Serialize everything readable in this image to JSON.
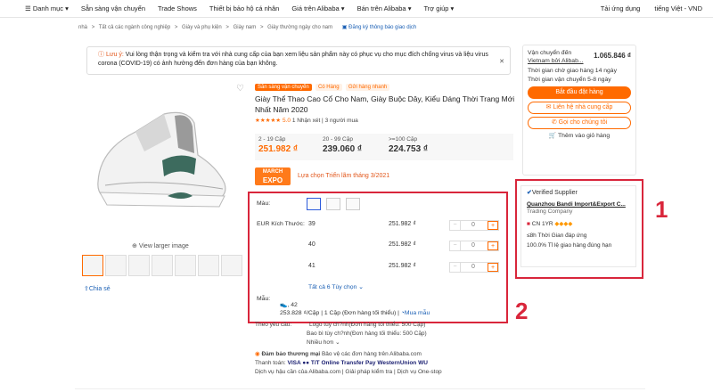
{
  "topnav": {
    "items": [
      "Danh mục",
      "Sẵn sàng vận chuyển",
      "Trade Shows",
      "Thiết bị bảo hộ cá nhân",
      "Giá trên Alibaba",
      "Bán trên Alibaba",
      "Trợ giúp"
    ],
    "right": [
      "Tải ứng dụng",
      "tiếng Việt - VND"
    ]
  },
  "breadcrumb": {
    "items": [
      "nhà",
      ">",
      "Tất cả các ngành công nghiệp",
      ">",
      "Giày và phụ kiện",
      ">",
      "Giày nam",
      ">",
      "Giày thường ngày cho nam"
    ],
    "report_link": "Đăng ký thông báo giao dịch"
  },
  "notice": {
    "warn": "Lưu ý:",
    "text": "Vui lòng thận trọng và kiểm tra với nhà cung cấp của bạn xem liệu sản phẩm này có phục vụ cho mục đích chống virus và liệu virus corona (COVID-19) có ảnh hưởng đến đơn hàng của bạn không."
  },
  "sidebar": {
    "ship_label": "Vận chuyển đến",
    "ship_price": "1.065.846 ₫",
    "ship_via": "Vietnam bởi Alibab...",
    "delivery": "Thời gian chờ giao hàng 14 ngày",
    "transit": "Thời gian vận chuyển 5-8 ngày",
    "buy_btn": "Bắt đầu đặt hàng",
    "contact_btn": "Liên hệ nhà cung cấp",
    "call_btn": "Gọi cho chúng tôi",
    "cart": "Thêm vào giỏ hàng"
  },
  "product": {
    "tags": [
      "Sẵn sàng vận chuyển",
      "Có Hàng",
      "Gửi hàng nhanh"
    ],
    "title": "Giày Thể Thao Cao Cổ Cho Nam, Giày Buộc Dây, Kiểu Dáng Thời Trang Mới Nhất Năm 2020",
    "stars": "★★★★★",
    "rating": "5.0",
    "reviews": "1 Nhận xét",
    "buyers": "3 người mua",
    "view_larger": "View larger image",
    "share": "Chia sẻ"
  },
  "tiers": [
    {
      "qty": "2 - 19 Cặp",
      "price": "251.982 ₫"
    },
    {
      "qty": "20 - 99 Cặp",
      "price": "239.060 ₫"
    },
    {
      "qty": ">=100 Cặp",
      "price": "224.753 ₫"
    }
  ],
  "expo": {
    "badge_line1": "MARCH",
    "badge_line2": "EXPO",
    "text": "Lựa chọn Triển lãm tháng 3/2021"
  },
  "variants": {
    "color_label": "Màu:",
    "size_label": "EUR Kích Thước:",
    "sizes": [
      {
        "size": "39",
        "price": "251.982 ₫",
        "qty": "0"
      },
      {
        "size": "40",
        "price": "251.982 ₫",
        "qty": "0"
      },
      {
        "size": "41",
        "price": "251.982 ₫",
        "qty": "0"
      }
    ],
    "all_sizes": "Tất cả 6 Tùy chọn",
    "sample_label": "Mẫu:",
    "sample_value": ", 42",
    "sample_price": "253.828 ₫/Cặp | 1 Cặp (Đơn hàng tối thiểu) |",
    "sample_link": "Mua mẫu"
  },
  "supplier": {
    "verified": "Verified Supplier",
    "name": "Quanzhou Bandi Import&Export C...",
    "type": "Trading Company",
    "country": "CN",
    "years": "1YR",
    "response": "≤8h Thời Gian đáp ứng",
    "on_time": "100.0% Tỉ lệ giao hàng đúng hạn"
  },
  "custom": {
    "label": "Theo yêu cầu:",
    "logo": "Logo tùy ch?nh(Đơn hàng tối thiểu: 500 Cặp)",
    "pack": "Bao bì tùy ch?nh(Đơn hàng tối thiểu: 500 Cặp)",
    "more": "Nhiều hơn"
  },
  "assurance": {
    "title": "Đảm bảo thương mại",
    "text": "Bảo vệ các đơn hàng trên Alibaba.com",
    "pay_label": "Thanh toán:",
    "pay": "VISA  ●●  T/T  Online Transfer  Pay  WesternUnion  WU",
    "services": "Dịch vụ hậu cần của Alibaba.com | Giải pháp kiểm tra | Dịch vụ One-stop"
  },
  "annotations": {
    "one": "1",
    "two": "2"
  },
  "colors": {
    "accent": "#ff6a00",
    "annotation": "#d9263b",
    "link": "#1a5fb4"
  }
}
